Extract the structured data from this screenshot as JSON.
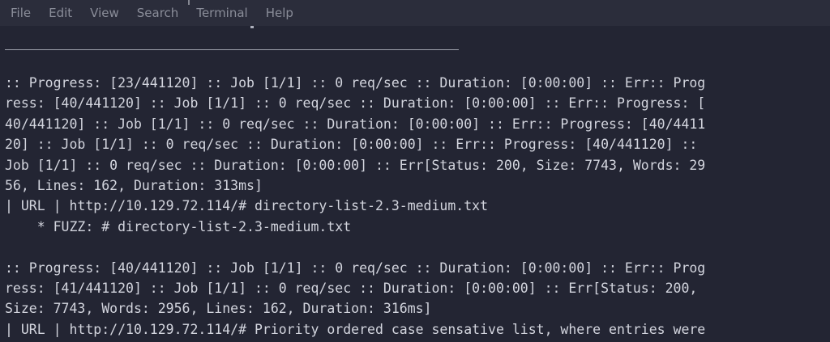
{
  "menubar": {
    "items": [
      "File",
      "Edit",
      "View",
      "Search",
      "Terminal",
      "Help"
    ]
  },
  "terminal": {
    "lines": [
      ":: Progress: [23/441120] :: Job [1/1] :: 0 req/sec :: Duration: [0:00:00] :: Err:: Prog",
      "ress: [40/441120] :: Job [1/1] :: 0 req/sec :: Duration: [0:00:00] :: Err:: Progress: [",
      "40/441120] :: Job [1/1] :: 0 req/sec :: Duration: [0:00:00] :: Err:: Progress: [40/4411",
      "20] :: Job [1/1] :: 0 req/sec :: Duration: [0:00:00] :: Err:: Progress: [40/441120] ::",
      "Job [1/1] :: 0 req/sec :: Duration: [0:00:00] :: Err[Status: 200, Size: 7743, Words: 29",
      "56, Lines: 162, Duration: 313ms]",
      "| URL | http://10.129.72.114/# directory-list-2.3-medium.txt",
      "    * FUZZ: # directory-list-2.3-medium.txt",
      "",
      ":: Progress: [40/441120] :: Job [1/1] :: 0 req/sec :: Duration: [0:00:00] :: Err:: Prog",
      "ress: [41/441120] :: Job [1/1] :: 0 req/sec :: Duration: [0:00:00] :: Err[Status: 200,",
      "Size: 7743, Words: 2956, Lines: 162, Duration: 316ms]",
      "| URL | http://10.129.72.114/# Priority ordered case sensative list, where entries were"
    ]
  },
  "colors": {
    "background": "#232533",
    "menubar": "#2b2d3b",
    "menu_text": "#8a8d99",
    "terminal_text": "#d3d5de"
  }
}
